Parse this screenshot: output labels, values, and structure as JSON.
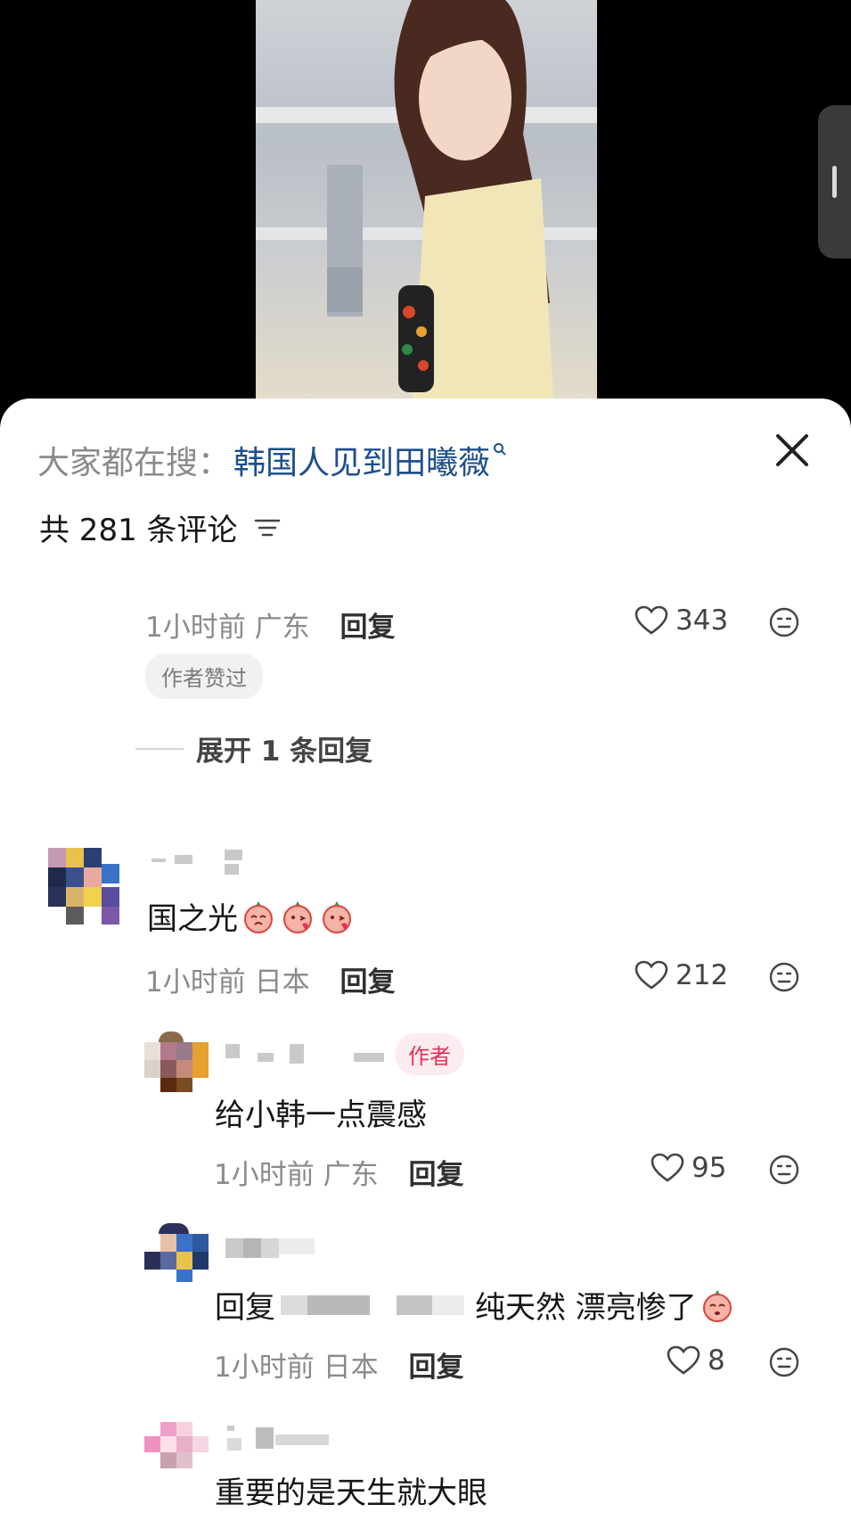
{
  "search": {
    "prefix": "大家都在搜：",
    "term": "韩国人见到田曦薇"
  },
  "comments_header": {
    "count_text": "共 281 条评论"
  },
  "comments": [
    {
      "time": "1小时前",
      "location": "广东",
      "reply_label": "回复",
      "likes": "343",
      "badge": "作者赞过"
    },
    {
      "text": "国之光",
      "time": "1小时前",
      "location": "日本",
      "reply_label": "回复",
      "likes": "212"
    }
  ],
  "expand": {
    "label": "展开 1 条回复"
  },
  "replies": [
    {
      "author_badge": "作者",
      "text": "给小韩一点震感",
      "time": "1小时前",
      "location": "广东",
      "reply_label": "回复",
      "likes": "95"
    },
    {
      "reply_prefix": "回复",
      "text": "纯天然 漂亮惨了",
      "time": "1小时前",
      "location": "日本",
      "reply_label": "回复",
      "likes": "8"
    },
    {
      "text": "重要的是天生就大眼"
    }
  ],
  "colors": {
    "accent_link": "#1d4f8c",
    "author_badge": "#e8305a",
    "sheet_bg": "#ffffff"
  }
}
